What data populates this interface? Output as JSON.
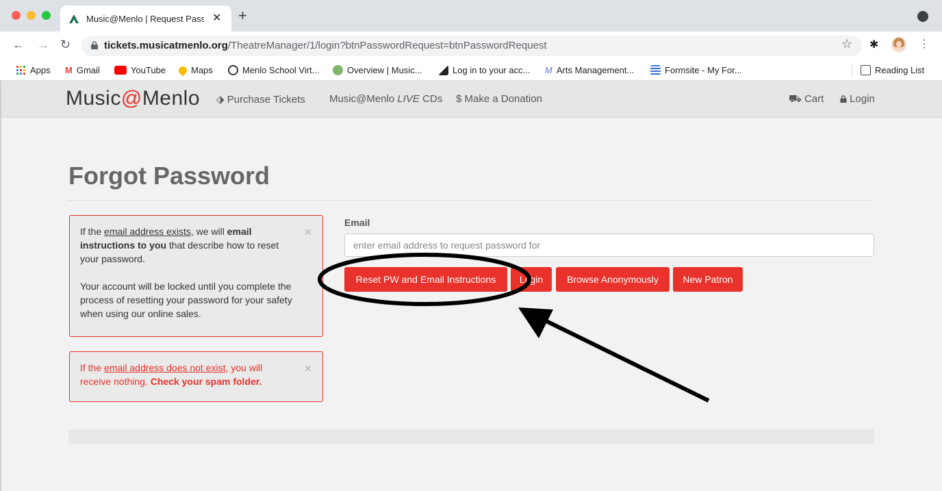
{
  "browser": {
    "tab_title": "Music@Menlo | Request Passw",
    "url_domain": "tickets.musicatmenlo.org",
    "url_path": "/TheatreManager/1/login?btnPasswordRequest=btnPasswordRequest",
    "bookmarks": [
      "Apps",
      "Gmail",
      "YouTube",
      "Maps",
      "Menlo School Virt...",
      "Overview | Music...",
      "Log in to your acc...",
      "Arts Management...",
      "Formsite - My For..."
    ],
    "reading_list": "Reading List"
  },
  "site": {
    "brand_prefix": "Music",
    "brand_at": "@",
    "brand_suffix": "Menlo",
    "nav": {
      "purchase": "Purchase Tickets",
      "cds_prefix": "Music@Menlo ",
      "cds_live": "LIVE",
      "cds_suffix": " CDs",
      "donation": "$ Make a Donation",
      "cart": "Cart",
      "login": "Login"
    }
  },
  "main": {
    "heading": "Forgot Password",
    "alert_exists": {
      "t1": "If the ",
      "t2": "email address exists,",
      "t3": " we will ",
      "t4": "email instructions to you",
      "t5": " that describe how to reset your password.",
      "p2": "Your account will be locked until you complete the process of resetting your password for your safety when using our online sales."
    },
    "alert_not_exists": {
      "t1": "If the ",
      "t2": "email address does not exist,",
      "t3": " you will receive nothing. ",
      "t4": "Check your spam folder."
    },
    "email_label": "Email",
    "email_placeholder": "enter email address to request password for",
    "buttons": {
      "reset": "Reset PW and Email Instructions",
      "login": "Login",
      "browse": "Browse Anonymously",
      "new_patron": "New Patron"
    }
  },
  "colors": {
    "accent": "#e8322b",
    "annotation": "#000000"
  }
}
